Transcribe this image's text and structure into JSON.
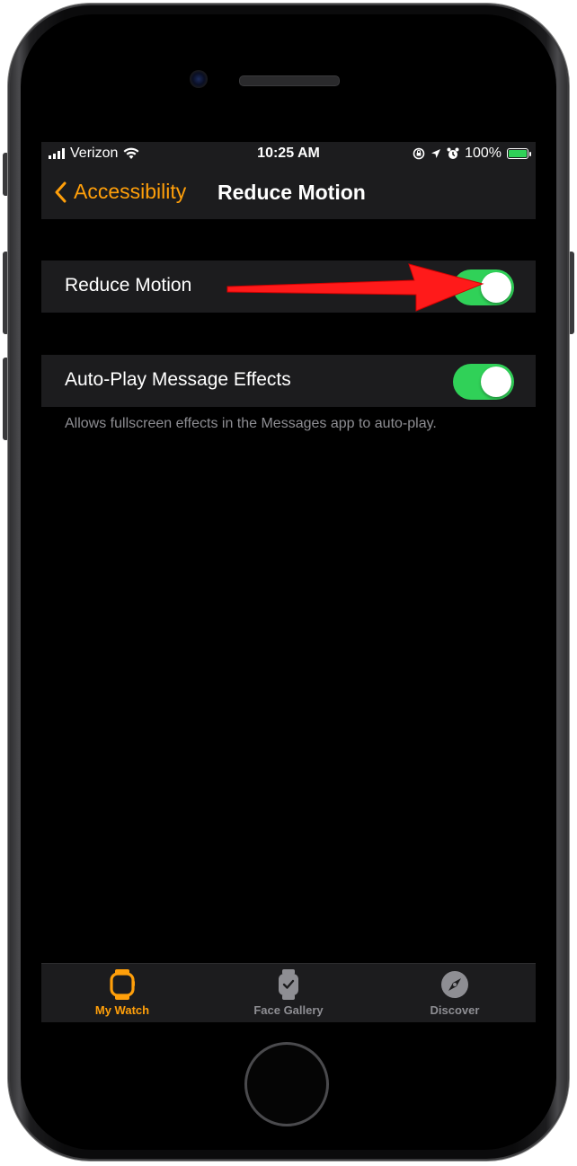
{
  "status_bar": {
    "carrier": "Verizon",
    "time": "10:25 AM",
    "battery": "100%"
  },
  "nav": {
    "back_label": "Accessibility",
    "title": "Reduce Motion"
  },
  "settings": {
    "reduce_motion": {
      "label": "Reduce Motion",
      "enabled": true
    },
    "auto_play": {
      "label": "Auto-Play Message Effects",
      "enabled": true
    },
    "footer": "Allows fullscreen effects in the Messages app to auto-play."
  },
  "tabs": [
    {
      "label": "My Watch",
      "icon": "watch-icon",
      "active": true
    },
    {
      "label": "Face Gallery",
      "icon": "watch-face-icon",
      "active": false
    },
    {
      "label": "Discover",
      "icon": "compass-icon",
      "active": false
    }
  ],
  "colors": {
    "accent": "#ff9f0a",
    "toggle_on": "#30d158",
    "annotation_arrow": "#ff1a1a",
    "inactive_tab": "#8e8e93"
  }
}
